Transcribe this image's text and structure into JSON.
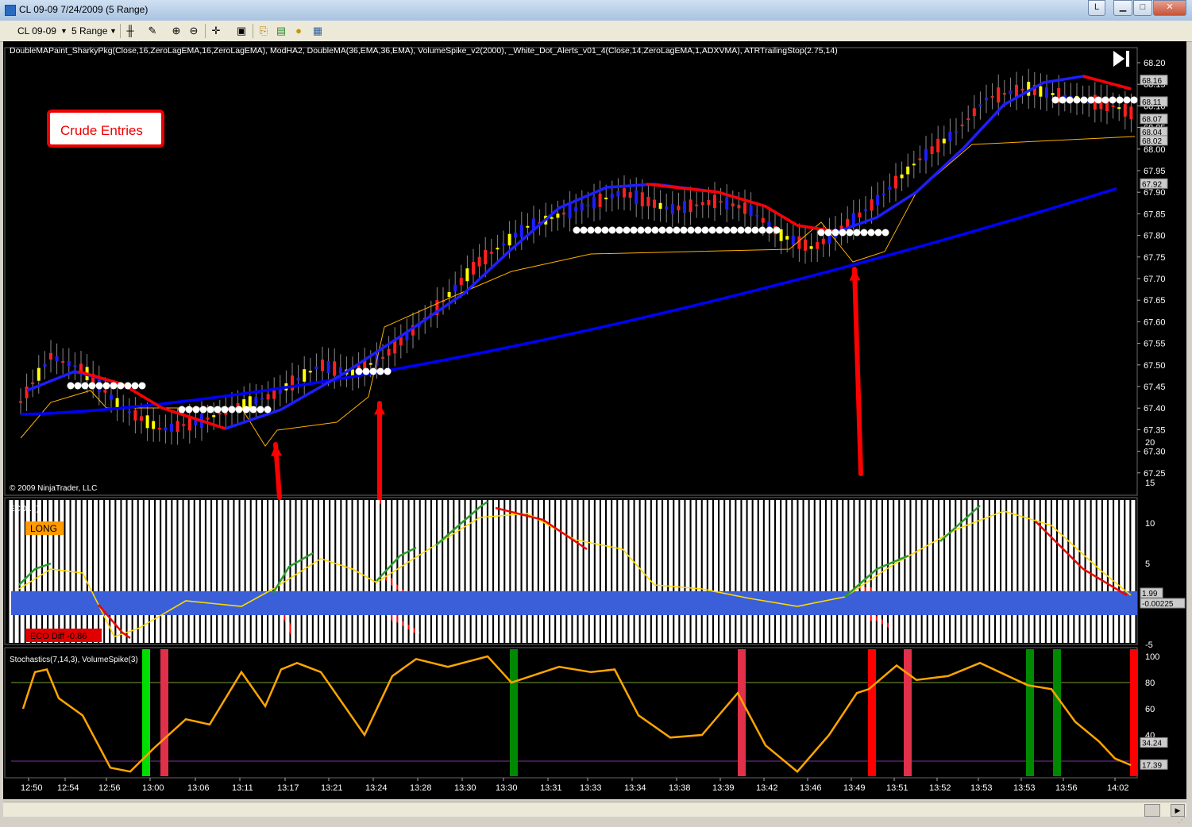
{
  "window": {
    "title": "CL 09-09  7/24/2009 (5 Range)",
    "link_button": "L",
    "minimize": "▁",
    "maximize": "□",
    "close": "✕"
  },
  "toolbar": {
    "instrument": "CL 09-09",
    "interval": "5 Range",
    "icons": [
      "bar-type-icon",
      "draw-tool-icon",
      "zoom-in-icon",
      "zoom-out-icon",
      "crosshair-icon",
      "properties-icon",
      "indicators-icon",
      "strategies-icon",
      "data-box-icon"
    ]
  },
  "price_panel": {
    "indicator_header": "DoubleMAPaint_SharkyPkg(Close,16,ZeroLagEMA,16,ZeroLagEMA), ModHA2, DoubleMA(36,EMA,36,EMA), VolumeSpike_v2(2000), _White_Dot_Alerts_v01_4(Close,14,ZeroLagEMA,1,ADXVMA), ATRTrailingStop(2.75,14)",
    "annotation": "Crude Entries",
    "copyright": "© 2009 NinjaTrader, LLC",
    "y_ticks": [
      "68.20",
      "68.15",
      "68.10",
      "68.05",
      "68.00",
      "67.95",
      "67.90",
      "67.85",
      "67.80",
      "67.75",
      "67.70",
      "67.65",
      "67.60",
      "67.55",
      "67.50",
      "67.45",
      "67.40",
      "67.35",
      "67.30",
      "67.25"
    ],
    "price_badges": [
      "68.16",
      "68.11",
      "68.07",
      "68.04",
      "68.02",
      "67.92"
    ],
    "play_icon": "play-end-icon"
  },
  "eco_panel": {
    "header": "ECO(...)",
    "long_label": "LONG",
    "diff_label": "ECO Diff -0.86",
    "y_ticks": [
      "20",
      "15",
      "10",
      "5",
      "0",
      "-5"
    ],
    "badges": [
      "1.99",
      "-0.00225"
    ]
  },
  "stoch_panel": {
    "header": "Stochastics(7,14,3), VolumeSpike(3)",
    "y_ticks": [
      "100",
      "80",
      "60",
      "40"
    ],
    "badges": [
      "34.24",
      "17.39"
    ]
  },
  "x_axis": [
    "12:50",
    "12:54",
    "12:56",
    "13:00",
    "13:06",
    "13:11",
    "13:17",
    "13:21",
    "13:24",
    "13:28",
    "13:30",
    "13:30",
    "13:31",
    "13:33",
    "13:34",
    "13:38",
    "13:39",
    "13:42",
    "13:46",
    "13:49",
    "13:51",
    "13:52",
    "13:53",
    "13:53",
    "13:56",
    "14:02"
  ],
  "colors": {
    "ema_fast_up": "#1e1eff",
    "ema_fast_down": "#ff0000",
    "ema_slow": "#0000ff",
    "trail": "#ffb000",
    "arrow": "#ff0000",
    "eco_band": "#3a5fd8",
    "stoch_line": "#ffa500"
  }
}
